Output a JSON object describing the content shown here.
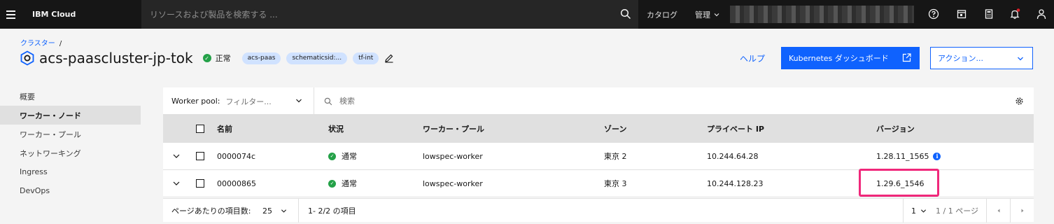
{
  "topbar": {
    "brand": "IBM Cloud",
    "search_placeholder": "リソースおよび製品を検索する ...",
    "catalog": "カタログ",
    "manage": "管理"
  },
  "header": {
    "breadcrumb": "クラスター",
    "breadcrumb_sep": "/",
    "title": "acs-paascluster-jp-tok",
    "status": "正常",
    "tags": [
      "acs-paas",
      "schematicsid:...",
      "tf-int"
    ],
    "help": "ヘルプ",
    "k8s_button": "Kubernetes ダッシュボード",
    "actions_button": "アクション..."
  },
  "sidebar": {
    "items": [
      {
        "label": "概要"
      },
      {
        "label": "ワーカー・ノード"
      },
      {
        "label": "ワーカー・プール"
      },
      {
        "label": "ネットワーキング"
      },
      {
        "label": "Ingress"
      },
      {
        "label": "DevOps"
      }
    ]
  },
  "table": {
    "pool_filter_label": "Worker pool:",
    "pool_filter_placeholder": "フィルター...",
    "search_placeholder": "検索",
    "columns": [
      "名前",
      "状況",
      "ワーカー・プール",
      "ゾーン",
      "プライベート IP",
      "バージョン"
    ],
    "rows": [
      {
        "name": "0000074c",
        "status": "通常",
        "pool": "lowspec-worker",
        "zone": "東京 2",
        "ip": "10.244.64.28",
        "version": "1.28.11_1565"
      },
      {
        "name": "00000865",
        "status": "通常",
        "pool": "lowspec-worker",
        "zone": "東京 3",
        "ip": "10.244.128.23",
        "version": "1.29.6_1546"
      }
    ],
    "pager": {
      "per_page_label": "ページあたりの項目数:",
      "per_page_value": "25",
      "range": "1- 2/2 の項目",
      "page_value": "1",
      "page_of": "1 / 1 ページ"
    }
  },
  "colors": {
    "accent": "#0f62fe",
    "success": "#24a148",
    "highlight": "#f0287b",
    "topbar": "#161616"
  }
}
